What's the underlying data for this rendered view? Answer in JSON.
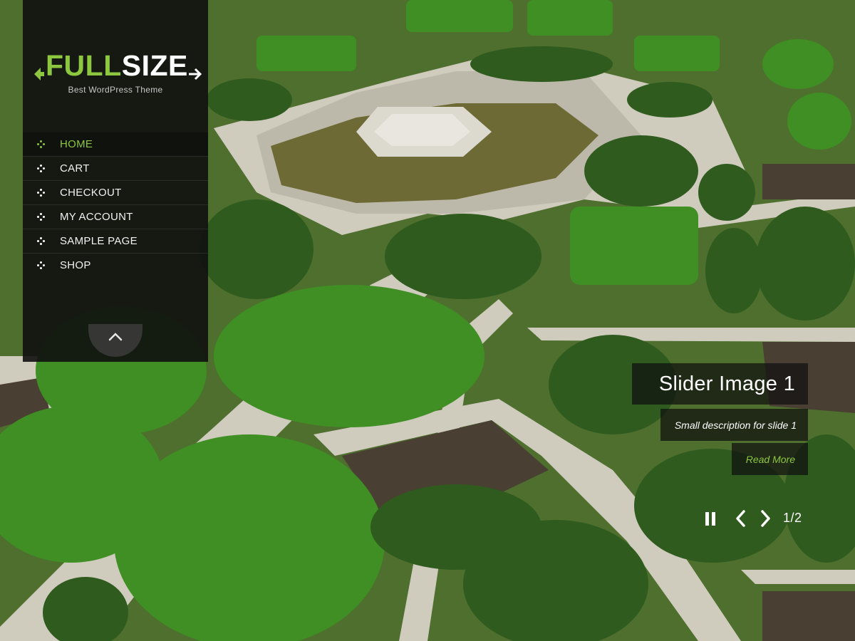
{
  "brand": {
    "name_part1": "FULL",
    "name_part2": "SIZE",
    "tagline": "Best WordPress Theme",
    "accent_color": "#8dc63f"
  },
  "menu": {
    "items": [
      {
        "label": "HOME",
        "active": true
      },
      {
        "label": "CART",
        "active": false
      },
      {
        "label": "CHECKOUT",
        "active": false
      },
      {
        "label": "MY ACCOUNT",
        "active": false
      },
      {
        "label": "SAMPLE PAGE",
        "active": false
      },
      {
        "label": "SHOP",
        "active": false
      }
    ],
    "collapse_icon": "chevron-up-icon"
  },
  "slider": {
    "title": "Slider Image 1",
    "description": "Small description for slide 1",
    "read_more": "Read More",
    "pager": "1/2",
    "controls": [
      "pause-icon",
      "chevron-left-icon",
      "chevron-right-icon"
    ]
  }
}
